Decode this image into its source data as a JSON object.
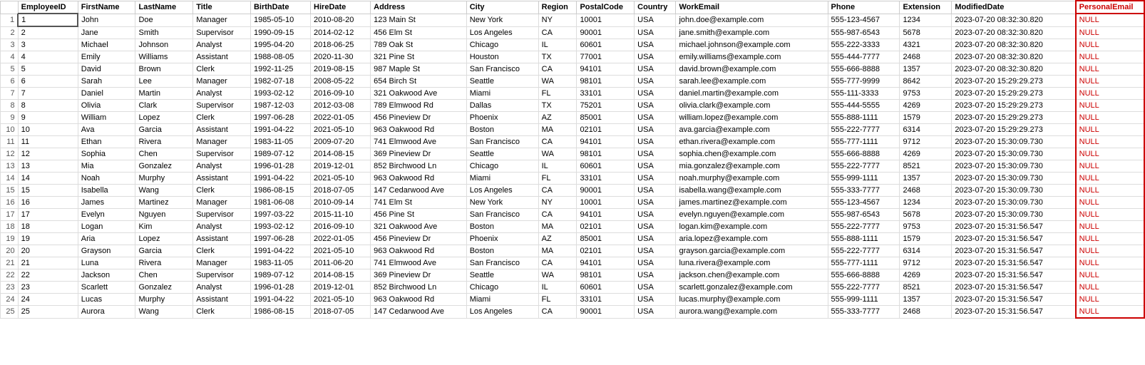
{
  "columns": [
    {
      "key": "rowNum",
      "label": ""
    },
    {
      "key": "employeeID",
      "label": "EmployeeID"
    },
    {
      "key": "firstName",
      "label": "FirstName"
    },
    {
      "key": "lastName",
      "label": "LastName"
    },
    {
      "key": "title",
      "label": "Title"
    },
    {
      "key": "birthDate",
      "label": "BirthDate"
    },
    {
      "key": "hireDate",
      "label": "HireDate"
    },
    {
      "key": "address",
      "label": "Address"
    },
    {
      "key": "city",
      "label": "City"
    },
    {
      "key": "region",
      "label": "Region"
    },
    {
      "key": "postalCode",
      "label": "PostalCode"
    },
    {
      "key": "country",
      "label": "Country"
    },
    {
      "key": "workEmail",
      "label": "WorkEmail"
    },
    {
      "key": "phone",
      "label": "Phone"
    },
    {
      "key": "extension",
      "label": "Extension"
    },
    {
      "key": "modifiedDate",
      "label": "ModifiedDate"
    },
    {
      "key": "personalEmail",
      "label": "PersonalEmail"
    }
  ],
  "rows": [
    {
      "rowNum": "1",
      "employeeID": "1",
      "firstName": "John",
      "lastName": "Doe",
      "title": "Manager",
      "birthDate": "1985-05-10",
      "hireDate": "2010-08-20",
      "address": "123 Main St",
      "city": "New York",
      "region": "NY",
      "postalCode": "10001",
      "country": "USA",
      "workEmail": "john.doe@example.com",
      "phone": "555-123-4567",
      "extension": "1234",
      "modifiedDate": "2023-07-20 08:32:30.820",
      "personalEmail": "NULL"
    },
    {
      "rowNum": "2",
      "employeeID": "2",
      "firstName": "Jane",
      "lastName": "Smith",
      "title": "Supervisor",
      "birthDate": "1990-09-15",
      "hireDate": "2014-02-12",
      "address": "456 Elm St",
      "city": "Los Angeles",
      "region": "CA",
      "postalCode": "90001",
      "country": "USA",
      "workEmail": "jane.smith@example.com",
      "phone": "555-987-6543",
      "extension": "5678",
      "modifiedDate": "2023-07-20 08:32:30.820",
      "personalEmail": "NULL"
    },
    {
      "rowNum": "3",
      "employeeID": "3",
      "firstName": "Michael",
      "lastName": "Johnson",
      "title": "Analyst",
      "birthDate": "1995-04-20",
      "hireDate": "2018-06-25",
      "address": "789 Oak St",
      "city": "Chicago",
      "region": "IL",
      "postalCode": "60601",
      "country": "USA",
      "workEmail": "michael.johnson@example.com",
      "phone": "555-222-3333",
      "extension": "4321",
      "modifiedDate": "2023-07-20 08:32:30.820",
      "personalEmail": "NULL"
    },
    {
      "rowNum": "4",
      "employeeID": "4",
      "firstName": "Emily",
      "lastName": "Williams",
      "title": "Assistant",
      "birthDate": "1988-08-05",
      "hireDate": "2020-11-30",
      "address": "321 Pine St",
      "city": "Houston",
      "region": "TX",
      "postalCode": "77001",
      "country": "USA",
      "workEmail": "emily.williams@example.com",
      "phone": "555-444-7777",
      "extension": "2468",
      "modifiedDate": "2023-07-20 08:32:30.820",
      "personalEmail": "NULL"
    },
    {
      "rowNum": "5",
      "employeeID": "5",
      "firstName": "David",
      "lastName": "Brown",
      "title": "Clerk",
      "birthDate": "1992-11-25",
      "hireDate": "2019-08-15",
      "address": "987 Maple St",
      "city": "San Francisco",
      "region": "CA",
      "postalCode": "94101",
      "country": "USA",
      "workEmail": "david.brown@example.com",
      "phone": "555-666-8888",
      "extension": "1357",
      "modifiedDate": "2023-07-20 08:32:30.820",
      "personalEmail": "NULL"
    },
    {
      "rowNum": "6",
      "employeeID": "6",
      "firstName": "Sarah",
      "lastName": "Lee",
      "title": "Manager",
      "birthDate": "1982-07-18",
      "hireDate": "2008-05-22",
      "address": "654 Birch St",
      "city": "Seattle",
      "region": "WA",
      "postalCode": "98101",
      "country": "USA",
      "workEmail": "sarah.lee@example.com",
      "phone": "555-777-9999",
      "extension": "8642",
      "modifiedDate": "2023-07-20 15:29:29.273",
      "personalEmail": "NULL"
    },
    {
      "rowNum": "7",
      "employeeID": "7",
      "firstName": "Daniel",
      "lastName": "Martin",
      "title": "Analyst",
      "birthDate": "1993-02-12",
      "hireDate": "2016-09-10",
      "address": "321 Oakwood Ave",
      "city": "Miami",
      "region": "FL",
      "postalCode": "33101",
      "country": "USA",
      "workEmail": "daniel.martin@example.com",
      "phone": "555-111-3333",
      "extension": "9753",
      "modifiedDate": "2023-07-20 15:29:29.273",
      "personalEmail": "NULL"
    },
    {
      "rowNum": "8",
      "employeeID": "8",
      "firstName": "Olivia",
      "lastName": "Clark",
      "title": "Supervisor",
      "birthDate": "1987-12-03",
      "hireDate": "2012-03-08",
      "address": "789 Elmwood Rd",
      "city": "Dallas",
      "region": "TX",
      "postalCode": "75201",
      "country": "USA",
      "workEmail": "olivia.clark@example.com",
      "phone": "555-444-5555",
      "extension": "4269",
      "modifiedDate": "2023-07-20 15:29:29.273",
      "personalEmail": "NULL"
    },
    {
      "rowNum": "9",
      "employeeID": "9",
      "firstName": "William",
      "lastName": "Lopez",
      "title": "Clerk",
      "birthDate": "1997-06-28",
      "hireDate": "2022-01-05",
      "address": "456 Pineview Dr",
      "city": "Phoenix",
      "region": "AZ",
      "postalCode": "85001",
      "country": "USA",
      "workEmail": "william.lopez@example.com",
      "phone": "555-888-1111",
      "extension": "1579",
      "modifiedDate": "2023-07-20 15:29:29.273",
      "personalEmail": "NULL"
    },
    {
      "rowNum": "10",
      "employeeID": "10",
      "firstName": "Ava",
      "lastName": "Garcia",
      "title": "Assistant",
      "birthDate": "1991-04-22",
      "hireDate": "2021-05-10",
      "address": "963 Oakwood Rd",
      "city": "Boston",
      "region": "MA",
      "postalCode": "02101",
      "country": "USA",
      "workEmail": "ava.garcia@example.com",
      "phone": "555-222-7777",
      "extension": "6314",
      "modifiedDate": "2023-07-20 15:29:29.273",
      "personalEmail": "NULL"
    },
    {
      "rowNum": "11",
      "employeeID": "11",
      "firstName": "Ethan",
      "lastName": "Rivera",
      "title": "Manager",
      "birthDate": "1983-11-05",
      "hireDate": "2009-07-20",
      "address": "741 Elmwood Ave",
      "city": "San Francisco",
      "region": "CA",
      "postalCode": "94101",
      "country": "USA",
      "workEmail": "ethan.rivera@example.com",
      "phone": "555-777-1111",
      "extension": "9712",
      "modifiedDate": "2023-07-20 15:30:09.730",
      "personalEmail": "NULL"
    },
    {
      "rowNum": "12",
      "employeeID": "12",
      "firstName": "Sophia",
      "lastName": "Chen",
      "title": "Supervisor",
      "birthDate": "1989-07-12",
      "hireDate": "2014-08-15",
      "address": "369 Pineview Dr",
      "city": "Seattle",
      "region": "WA",
      "postalCode": "98101",
      "country": "USA",
      "workEmail": "sophia.chen@example.com",
      "phone": "555-666-8888",
      "extension": "4269",
      "modifiedDate": "2023-07-20 15:30:09.730",
      "personalEmail": "NULL"
    },
    {
      "rowNum": "13",
      "employeeID": "13",
      "firstName": "Mia",
      "lastName": "Gonzalez",
      "title": "Analyst",
      "birthDate": "1996-01-28",
      "hireDate": "2019-12-01",
      "address": "852 Birchwood Ln",
      "city": "Chicago",
      "region": "IL",
      "postalCode": "60601",
      "country": "USA",
      "workEmail": "mia.gonzalez@example.com",
      "phone": "555-222-7777",
      "extension": "8521",
      "modifiedDate": "2023-07-20 15:30:09.730",
      "personalEmail": "NULL"
    },
    {
      "rowNum": "14",
      "employeeID": "14",
      "firstName": "Noah",
      "lastName": "Murphy",
      "title": "Assistant",
      "birthDate": "1991-04-22",
      "hireDate": "2021-05-10",
      "address": "963 Oakwood Rd",
      "city": "Miami",
      "region": "FL",
      "postalCode": "33101",
      "country": "USA",
      "workEmail": "noah.murphy@example.com",
      "phone": "555-999-1111",
      "extension": "1357",
      "modifiedDate": "2023-07-20 15:30:09.730",
      "personalEmail": "NULL"
    },
    {
      "rowNum": "15",
      "employeeID": "15",
      "firstName": "Isabella",
      "lastName": "Wang",
      "title": "Clerk",
      "birthDate": "1986-08-15",
      "hireDate": "2018-07-05",
      "address": "147 Cedarwood Ave",
      "city": "Los Angeles",
      "region": "CA",
      "postalCode": "90001",
      "country": "USA",
      "workEmail": "isabella.wang@example.com",
      "phone": "555-333-7777",
      "extension": "2468",
      "modifiedDate": "2023-07-20 15:30:09.730",
      "personalEmail": "NULL"
    },
    {
      "rowNum": "16",
      "employeeID": "16",
      "firstName": "James",
      "lastName": "Martinez",
      "title": "Manager",
      "birthDate": "1981-06-08",
      "hireDate": "2010-09-14",
      "address": "741 Elm St",
      "city": "New York",
      "region": "NY",
      "postalCode": "10001",
      "country": "USA",
      "workEmail": "james.martinez@example.com",
      "phone": "555-123-4567",
      "extension": "1234",
      "modifiedDate": "2023-07-20 15:30:09.730",
      "personalEmail": "NULL"
    },
    {
      "rowNum": "17",
      "employeeID": "17",
      "firstName": "Evelyn",
      "lastName": "Nguyen",
      "title": "Supervisor",
      "birthDate": "1997-03-22",
      "hireDate": "2015-11-10",
      "address": "456 Pine St",
      "city": "San Francisco",
      "region": "CA",
      "postalCode": "94101",
      "country": "USA",
      "workEmail": "evelyn.nguyen@example.com",
      "phone": "555-987-6543",
      "extension": "5678",
      "modifiedDate": "2023-07-20 15:30:09.730",
      "personalEmail": "NULL"
    },
    {
      "rowNum": "18",
      "employeeID": "18",
      "firstName": "Logan",
      "lastName": "Kim",
      "title": "Analyst",
      "birthDate": "1993-02-12",
      "hireDate": "2016-09-10",
      "address": "321 Oakwood Ave",
      "city": "Boston",
      "region": "MA",
      "postalCode": "02101",
      "country": "USA",
      "workEmail": "logan.kim@example.com",
      "phone": "555-222-7777",
      "extension": "9753",
      "modifiedDate": "2023-07-20 15:31:56.547",
      "personalEmail": "NULL"
    },
    {
      "rowNum": "19",
      "employeeID": "19",
      "firstName": "Aria",
      "lastName": "Lopez",
      "title": "Assistant",
      "birthDate": "1997-06-28",
      "hireDate": "2022-01-05",
      "address": "456 Pineview Dr",
      "city": "Phoenix",
      "region": "AZ",
      "postalCode": "85001",
      "country": "USA",
      "workEmail": "aria.lopez@example.com",
      "phone": "555-888-1111",
      "extension": "1579",
      "modifiedDate": "2023-07-20 15:31:56.547",
      "personalEmail": "NULL"
    },
    {
      "rowNum": "20",
      "employeeID": "20",
      "firstName": "Grayson",
      "lastName": "Garcia",
      "title": "Clerk",
      "birthDate": "1991-04-22",
      "hireDate": "2021-05-10",
      "address": "963 Oakwood Rd",
      "city": "Boston",
      "region": "MA",
      "postalCode": "02101",
      "country": "USA",
      "workEmail": "grayson.garcia@example.com",
      "phone": "555-222-7777",
      "extension": "6314",
      "modifiedDate": "2023-07-20 15:31:56.547",
      "personalEmail": "NULL"
    },
    {
      "rowNum": "21",
      "employeeID": "21",
      "firstName": "Luna",
      "lastName": "Rivera",
      "title": "Manager",
      "birthDate": "1983-11-05",
      "hireDate": "2011-06-20",
      "address": "741 Elmwood Ave",
      "city": "San Francisco",
      "region": "CA",
      "postalCode": "94101",
      "country": "USA",
      "workEmail": "luna.rivera@example.com",
      "phone": "555-777-1111",
      "extension": "9712",
      "modifiedDate": "2023-07-20 15:31:56.547",
      "personalEmail": "NULL"
    },
    {
      "rowNum": "22",
      "employeeID": "22",
      "firstName": "Jackson",
      "lastName": "Chen",
      "title": "Supervisor",
      "birthDate": "1989-07-12",
      "hireDate": "2014-08-15",
      "address": "369 Pineview Dr",
      "city": "Seattle",
      "region": "WA",
      "postalCode": "98101",
      "country": "USA",
      "workEmail": "jackson.chen@example.com",
      "phone": "555-666-8888",
      "extension": "4269",
      "modifiedDate": "2023-07-20 15:31:56.547",
      "personalEmail": "NULL"
    },
    {
      "rowNum": "23",
      "employeeID": "23",
      "firstName": "Scarlett",
      "lastName": "Gonzalez",
      "title": "Analyst",
      "birthDate": "1996-01-28",
      "hireDate": "2019-12-01",
      "address": "852 Birchwood Ln",
      "city": "Chicago",
      "region": "IL",
      "postalCode": "60601",
      "country": "USA",
      "workEmail": "scarlett.gonzalez@example.com",
      "phone": "555-222-7777",
      "extension": "8521",
      "modifiedDate": "2023-07-20 15:31:56.547",
      "personalEmail": "NULL"
    },
    {
      "rowNum": "24",
      "employeeID": "24",
      "firstName": "Lucas",
      "lastName": "Murphy",
      "title": "Assistant",
      "birthDate": "1991-04-22",
      "hireDate": "2021-05-10",
      "address": "963 Oakwood Rd",
      "city": "Miami",
      "region": "FL",
      "postalCode": "33101",
      "country": "USA",
      "workEmail": "lucas.murphy@example.com",
      "phone": "555-999-1111",
      "extension": "1357",
      "modifiedDate": "2023-07-20 15:31:56.547",
      "personalEmail": "NULL"
    },
    {
      "rowNum": "25",
      "employeeID": "25",
      "firstName": "Aurora",
      "lastName": "Wang",
      "title": "Clerk",
      "birthDate": "1986-08-15",
      "hireDate": "2018-07-05",
      "address": "147 Cedarwood Ave",
      "city": "Los Angeles",
      "region": "CA",
      "postalCode": "90001",
      "country": "USA",
      "workEmail": "aurora.wang@example.com",
      "phone": "555-333-7777",
      "extension": "2468",
      "modifiedDate": "2023-07-20 15:31:56.547",
      "personalEmail": "NULL"
    }
  ]
}
